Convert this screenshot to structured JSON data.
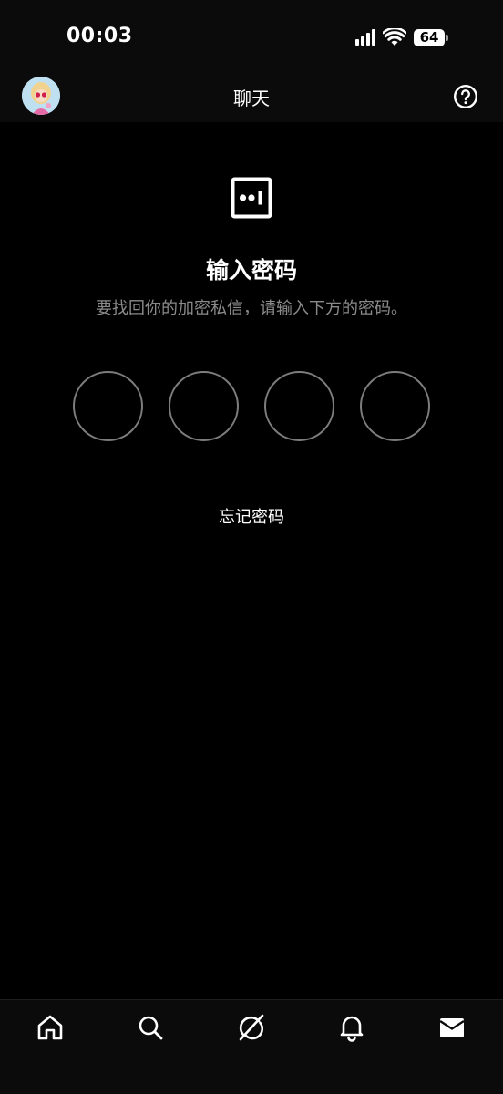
{
  "status_bar": {
    "time": "00:03",
    "battery": "64"
  },
  "header": {
    "title": "聊天"
  },
  "main": {
    "heading": "输入密码",
    "subtitle": "要找回你的加密私信，请输入下方的密码。",
    "pin_length": 4,
    "forgot_link": "忘记密码"
  },
  "bottom_nav": {
    "items": [
      "home-icon",
      "search-icon",
      "grok-icon",
      "notifications-icon",
      "messages-icon"
    ],
    "active": "messages-icon"
  },
  "colors": {
    "background": "#000000",
    "bar_background": "#0b0b0b",
    "subtitle_gray": "#8a8a8a",
    "pin_border": "#7d7d7d"
  }
}
